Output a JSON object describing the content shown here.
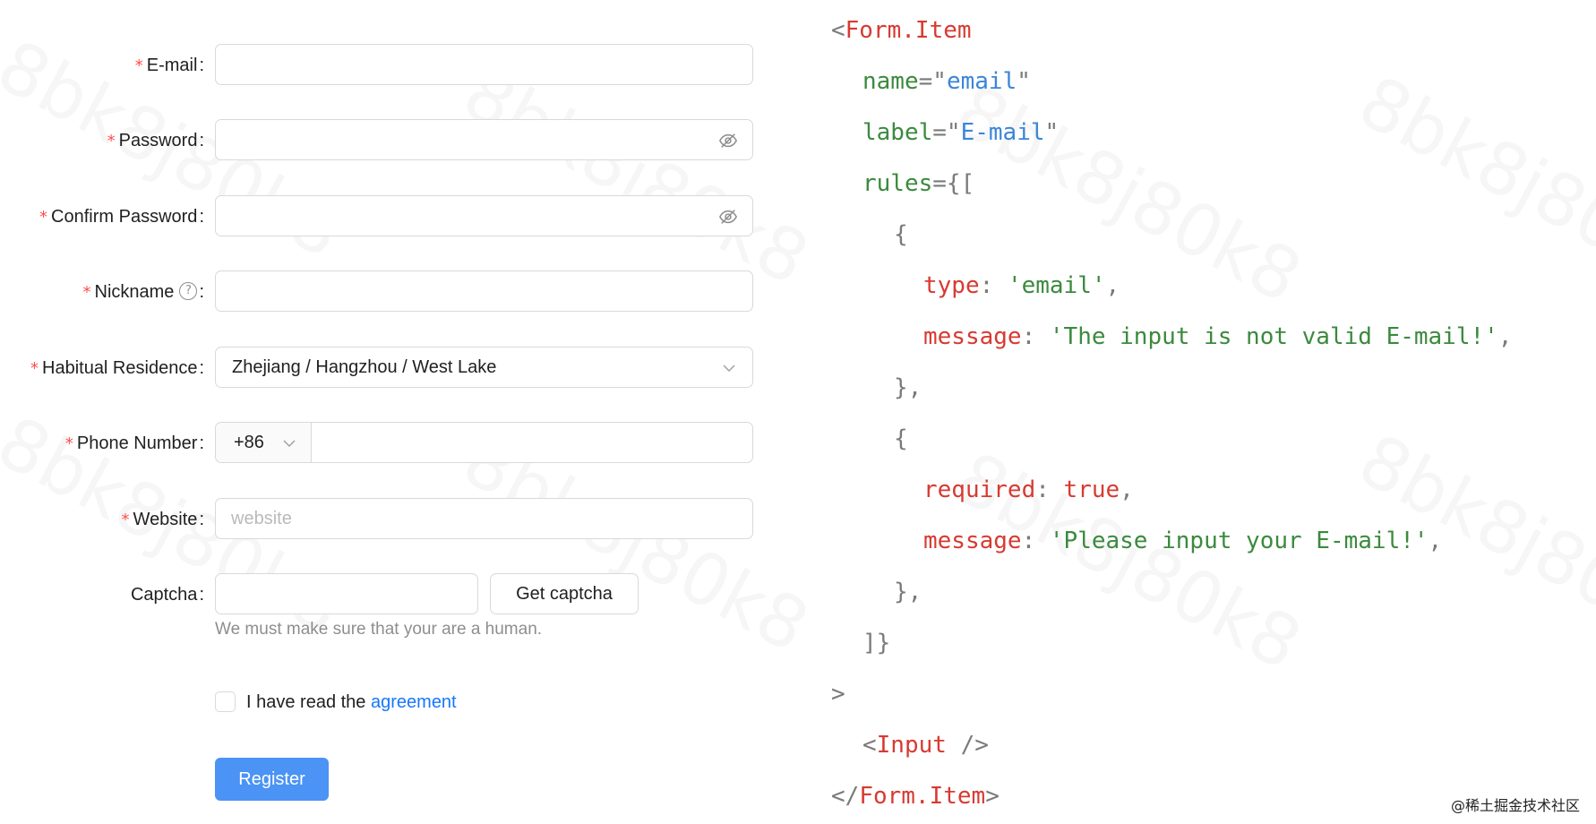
{
  "watermark": "8bk8j80k8",
  "form": {
    "email": {
      "label": "E-mail",
      "value": ""
    },
    "password": {
      "label": "Password",
      "value": ""
    },
    "confirm": {
      "label": "Confirm Password",
      "value": ""
    },
    "nickname": {
      "label": "Nickname",
      "value": "",
      "help_icon": "question-circle-icon",
      "help_glyph": "?"
    },
    "residence": {
      "label": "Habitual Residence",
      "value": "Zhejiang / Hangzhou / West Lake"
    },
    "phone": {
      "label": "Phone Number",
      "prefix": "+86",
      "value": ""
    },
    "website": {
      "label": "Website",
      "placeholder": "website",
      "value": ""
    },
    "captcha": {
      "label": "Captcha",
      "value": "",
      "button": "Get captcha",
      "extra": "We must make sure that your are a human."
    },
    "agreement": {
      "text": "I have read the",
      "link": "agreement"
    },
    "register": "Register",
    "colon": ":",
    "required_mark": "*"
  },
  "code": {
    "l1_open": "<",
    "l1_tag": "Form.Item",
    "l2_attr": "name",
    "l2_eq": "=\"",
    "l2_val": "email",
    "l2_q": "\"",
    "l3_attr": "label",
    "l3_eq": "=\"",
    "l3_val": "E-mail",
    "l3_q": "\"",
    "l4_attr": "rules",
    "l4_p": "={[",
    "l5": "{",
    "l6_key": "type",
    "l6_colon": ": ",
    "l6_str": "'email'",
    "l6_comma": ",",
    "l7_key": "message",
    "l7_colon": ": ",
    "l7_str": "'The input is not valid E-mail!'",
    "l7_comma": ",",
    "l8": "},",
    "l9": "{",
    "l10_key": "required",
    "l10_colon": ": ",
    "l10_kw": "true",
    "l10_comma": ",",
    "l11_key": "message",
    "l11_colon": ": ",
    "l11_str": "'Please input your E-mail!'",
    "l11_comma": ",",
    "l12": "},",
    "l13": "]}",
    "l14": ">",
    "l15_open": "<",
    "l15_tag": "Input",
    "l15_close": " />",
    "l16_open": "</",
    "l16_tag": "Form.Item",
    "l16_close": ">"
  },
  "credit": "@稀土掘金技术社区",
  "colors": {
    "primary": "#4b93f5",
    "required": "#ff4d4f",
    "link": "#1677ff",
    "tag": "#d73a32",
    "string": "#3b8a3e",
    "value": "#3a86d8"
  }
}
